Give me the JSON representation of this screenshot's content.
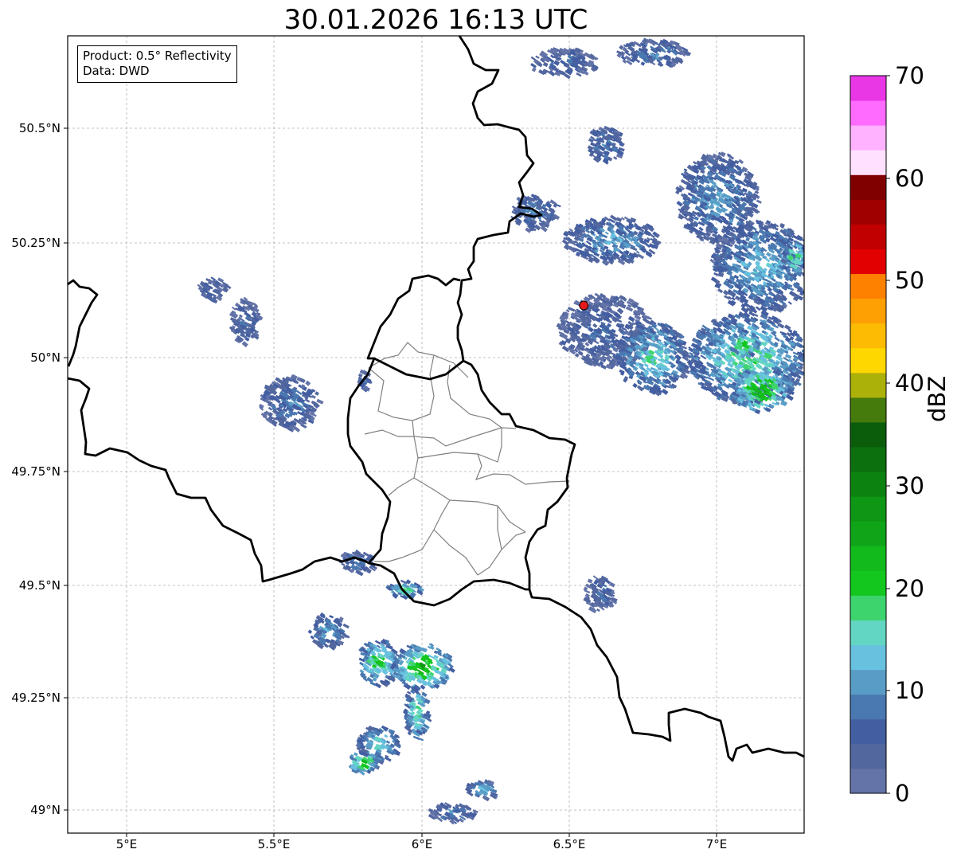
{
  "title": "30.01.2026 16:13 UTC",
  "info_box": {
    "product": "Product: 0.5° Reflectivity",
    "data": "Data: DWD"
  },
  "axes": {
    "lat_ticks": [
      "50.5°N",
      "50.25°N",
      "50°N",
      "49.75°N",
      "49.5°N",
      "49.25°N",
      "49°N"
    ],
    "lon_ticks": [
      "5°E",
      "5.5°E",
      "6°E",
      "6.5°E",
      "7°E"
    ],
    "lat_range": [
      48.95,
      50.7
    ],
    "lon_range": [
      4.8,
      7.3
    ],
    "grid": true
  },
  "radar_site": {
    "lat": 50.11,
    "lon": 6.55,
    "color": "#e41a1c"
  },
  "colorbar": {
    "label": "dBZ",
    "ticks": [
      "0",
      "10",
      "20",
      "30",
      "40",
      "50",
      "60",
      "70"
    ],
    "range": [
      0,
      70
    ],
    "step": 2.5,
    "colors": [
      "#6474a8",
      "#53679f",
      "#435ea1",
      "#4a78b0",
      "#599dc7",
      "#67c1df",
      "#63d6c3",
      "#3dd46e",
      "#14c71f",
      "#12ba1c",
      "#10a518",
      "#0e9614",
      "#0c8210",
      "#0b700d",
      "#0b5d0b",
      "#457a0d",
      "#acb10a",
      "#fed700",
      "#fdbb03",
      "#fe9f04",
      "#ff8100",
      "#e20001",
      "#c10001",
      "#a00000",
      "#800000",
      "#ffe1ff",
      "#ffb2ff",
      "#ff6aff",
      "#e937e6"
    ]
  },
  "chart_data": {
    "type": "heatmap",
    "title": "30.01.2026 16:13 UTC",
    "xlabel": "",
    "ylabel": "",
    "xlim": [
      4.8,
      7.3
    ],
    "ylim": [
      48.95,
      50.7
    ],
    "colorbar_label": "dBZ",
    "echo_regions": [
      {
        "lon": 6.62,
        "lat": 50.47,
        "rlon": 0.06,
        "rlat": 0.04,
        "dbz": 8
      },
      {
        "lon": 6.48,
        "lat": 50.65,
        "rlon": 0.12,
        "rlat": 0.03,
        "dbz": 6
      },
      {
        "lon": 6.78,
        "lat": 50.67,
        "rlon": 0.12,
        "rlat": 0.03,
        "dbz": 8
      },
      {
        "lon": 6.38,
        "lat": 50.32,
        "rlon": 0.08,
        "rlat": 0.04,
        "dbz": 8
      },
      {
        "lon": 6.64,
        "lat": 50.26,
        "rlon": 0.16,
        "rlat": 0.05,
        "dbz": 10
      },
      {
        "lon": 6.62,
        "lat": 50.06,
        "rlon": 0.16,
        "rlat": 0.08,
        "dbz": 6
      },
      {
        "lon": 6.78,
        "lat": 50.0,
        "rlon": 0.12,
        "rlat": 0.08,
        "dbz": 14
      },
      {
        "lon": 7.0,
        "lat": 50.35,
        "rlon": 0.14,
        "rlat": 0.1,
        "dbz": 10
      },
      {
        "lon": 7.15,
        "lat": 50.2,
        "rlon": 0.17,
        "rlat": 0.1,
        "dbz": 12
      },
      {
        "lon": 7.1,
        "lat": 50.0,
        "rlon": 0.2,
        "rlat": 0.1,
        "dbz": 16
      },
      {
        "lon": 7.15,
        "lat": 49.93,
        "rlon": 0.1,
        "rlat": 0.05,
        "dbz": 22
      },
      {
        "lon": 7.09,
        "lat": 50.03,
        "rlon": 0.05,
        "rlat": 0.03,
        "dbz": 20
      },
      {
        "lon": 7.26,
        "lat": 50.22,
        "rlon": 0.04,
        "rlat": 0.04,
        "dbz": 18
      },
      {
        "lon": 5.29,
        "lat": 50.15,
        "rlon": 0.05,
        "rlat": 0.025,
        "dbz": 6
      },
      {
        "lon": 5.4,
        "lat": 50.08,
        "rlon": 0.05,
        "rlat": 0.05,
        "dbz": 6
      },
      {
        "lon": 5.55,
        "lat": 49.9,
        "rlon": 0.1,
        "rlat": 0.06,
        "dbz": 8
      },
      {
        "lon": 5.78,
        "lat": 49.55,
        "rlon": 0.06,
        "rlat": 0.025,
        "dbz": 8
      },
      {
        "lon": 5.94,
        "lat": 49.49,
        "rlon": 0.06,
        "rlat": 0.02,
        "dbz": 16
      },
      {
        "lon": 6.6,
        "lat": 49.48,
        "rlon": 0.05,
        "rlat": 0.04,
        "dbz": 6
      },
      {
        "lon": 5.68,
        "lat": 49.4,
        "rlon": 0.06,
        "rlat": 0.04,
        "dbz": 10
      },
      {
        "lon": 5.85,
        "lat": 49.33,
        "rlon": 0.07,
        "rlat": 0.05,
        "dbz": 18
      },
      {
        "lon": 6.0,
        "lat": 49.32,
        "rlon": 0.1,
        "rlat": 0.05,
        "dbz": 22
      },
      {
        "lon": 5.98,
        "lat": 49.22,
        "rlon": 0.04,
        "rlat": 0.06,
        "dbz": 16
      },
      {
        "lon": 5.85,
        "lat": 49.15,
        "rlon": 0.07,
        "rlat": 0.04,
        "dbz": 14
      },
      {
        "lon": 5.8,
        "lat": 49.11,
        "rlon": 0.05,
        "rlat": 0.025,
        "dbz": 20
      },
      {
        "lon": 6.2,
        "lat": 49.05,
        "rlon": 0.05,
        "rlat": 0.02,
        "dbz": 12
      },
      {
        "lon": 6.1,
        "lat": 49.0,
        "rlon": 0.08,
        "rlat": 0.02,
        "dbz": 8
      },
      {
        "lon": 5.8,
        "lat": 49.95,
        "rlon": 0.02,
        "rlat": 0.02,
        "dbz": 6
      }
    ]
  }
}
